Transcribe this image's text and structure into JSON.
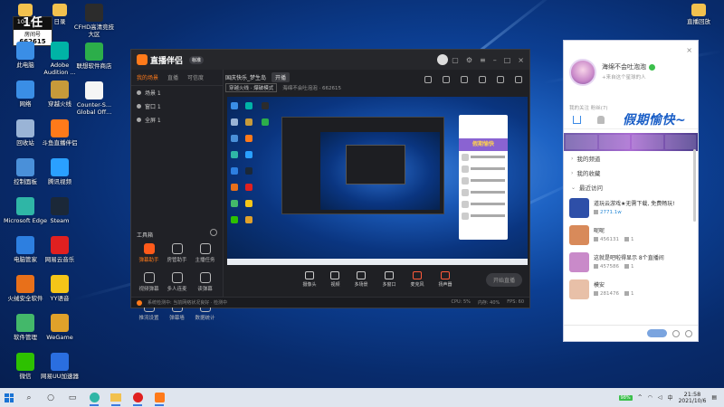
{
  "desktop_icons_left": [
    {
      "label": "此电脑",
      "icon": "computer-icon",
      "color": "#3a8ee6"
    },
    {
      "label": "网络",
      "icon": "network-icon",
      "color": "#3a8ee6"
    },
    {
      "label": "回收站",
      "icon": "recycle-bin-icon",
      "color": "#9ab4d6"
    },
    {
      "label": "控制面板",
      "icon": "control-panel-icon",
      "color": "#4a90d9"
    },
    {
      "label": "Microsoft Edge",
      "icon": "edge-icon",
      "color": "#2fb6a6"
    },
    {
      "label": "电脑管家",
      "icon": "pc-manager-icon",
      "color": "#2d7fe0"
    },
    {
      "label": "火绒安全软件",
      "icon": "huorong-icon",
      "color": "#e8701a"
    },
    {
      "label": "软件管理",
      "icon": "software-manager-icon",
      "color": "#43b86a"
    },
    {
      "label": "微信",
      "icon": "wechat-icon",
      "color": "#2dc100"
    }
  ],
  "desktop_icons_col2": [
    {
      "label": "Adobe Audition ...",
      "icon": "audition-icon",
      "color": "#00b3a6"
    },
    {
      "label": "穿越火线",
      "icon": "crossfire-icon",
      "color": "#c79a3a"
    },
    {
      "label": "斗鱼直播伴侣",
      "icon": "douyu-icon",
      "color": "#ff7a1a"
    },
    {
      "label": "腾讯视频",
      "icon": "tencent-video-icon",
      "color": "#2aa0ff"
    },
    {
      "label": "Steam",
      "icon": "steam-icon",
      "color": "#1b2838"
    },
    {
      "label": "网易云音乐",
      "icon": "netease-music-icon",
      "color": "#e02020"
    },
    {
      "label": "YY语音",
      "icon": "yy-icon",
      "color": "#f5c518"
    },
    {
      "label": "WeGame",
      "icon": "wegame-icon",
      "color": "#e0a12a"
    },
    {
      "label": "网易UU加速器",
      "icon": "uu-icon",
      "color": "#2a6ee0"
    }
  ],
  "desktop_icons_col3": [
    {
      "label": "CFHD高清竞技大区",
      "icon": "cfhd-icon",
      "color": "#2c2c2c"
    },
    {
      "label": "联想软件商店",
      "icon": "lenovo-store-icon",
      "color": "#2cae4a"
    },
    {
      "label": "Counter-S... Global Off...",
      "icon": "csgo-icon",
      "color": "#f5f5f5"
    }
  ],
  "desktop_top_col2": "日录",
  "desktop_top_col1": "104...",
  "desktop_right_icon": {
    "label": "直播回放",
    "icon": "folder-icon",
    "color": "#f2c14e"
  },
  "room_badge": {
    "title": "1任",
    "label": "房间号",
    "number": "662615"
  },
  "app": {
    "name": "直播伴侣",
    "version_badge": "标准",
    "tabs": [
      "我的场景",
      "直播",
      "可信度"
    ],
    "scenes": [
      "场景 1",
      "窗口 1",
      "全屏 1"
    ],
    "room_title": "国庆快乐_梦生岛",
    "room_status": "开播",
    "category_pill": "穿越火线 · 爆破模式",
    "category_info": "海绵不会吐泡泡 · 662615",
    "tools_title": "工具箱",
    "tools": [
      {
        "label": "弹幕助手",
        "hot": true
      },
      {
        "label": "房管助手",
        "hot": false
      },
      {
        "label": "主播任务",
        "hot": false
      },
      {
        "label": "视频弹幕",
        "hot": false
      },
      {
        "label": "多人连麦",
        "hot": false
      },
      {
        "label": "读弹幕",
        "hot": false
      },
      {
        "label": "推流设置",
        "hot": false
      },
      {
        "label": "弹幕墙",
        "hot": false
      },
      {
        "label": "数据统计",
        "hot": false
      }
    ],
    "controls": [
      {
        "label": "摄像头",
        "red": false
      },
      {
        "label": "视频",
        "red": false
      },
      {
        "label": "多场景",
        "red": false
      },
      {
        "label": "多窗口",
        "red": false
      },
      {
        "label": "麦克风",
        "red": true
      },
      {
        "label": "扬声器",
        "red": true
      }
    ],
    "start_button": "开始直播",
    "status_text": "系统检测中: 当前网络状况良好 · 检测中",
    "status_stats": [
      "CPU: 5%",
      "内存: 40%",
      "FPS: 60"
    ],
    "preview_chat_promo": "假期愉快"
  },
  "chat": {
    "name": "海绵不会吐泡泡",
    "signature": "+来自这个星球的人",
    "close_label": "×",
    "subheader": "我的关注 粉丝(7)",
    "promo": "假期愉快~",
    "sections": [
      "我的频道",
      "我的收藏",
      "最近访问"
    ],
    "conversations": [
      {
        "name": "道玩云游戏★无需下载, 免费畅玩!",
        "views": "2771.1w",
        "count": "",
        "highlight": true,
        "color": "#2e4fa8"
      },
      {
        "name": "呢呢",
        "views": "456131",
        "count": "1",
        "highlight": false,
        "color": "#d88a5a"
      },
      {
        "name": "这就是吧啦得显示 8个直播间",
        "views": "457586",
        "count": "1",
        "highlight": false,
        "color": "#c98ac9"
      },
      {
        "name": "模安",
        "views": "281476",
        "count": "1",
        "highlight": false,
        "color": "#e8c0a8"
      }
    ]
  },
  "taskbar": {
    "battery": "98%",
    "time": "21:58",
    "date": "2021/10/6"
  }
}
